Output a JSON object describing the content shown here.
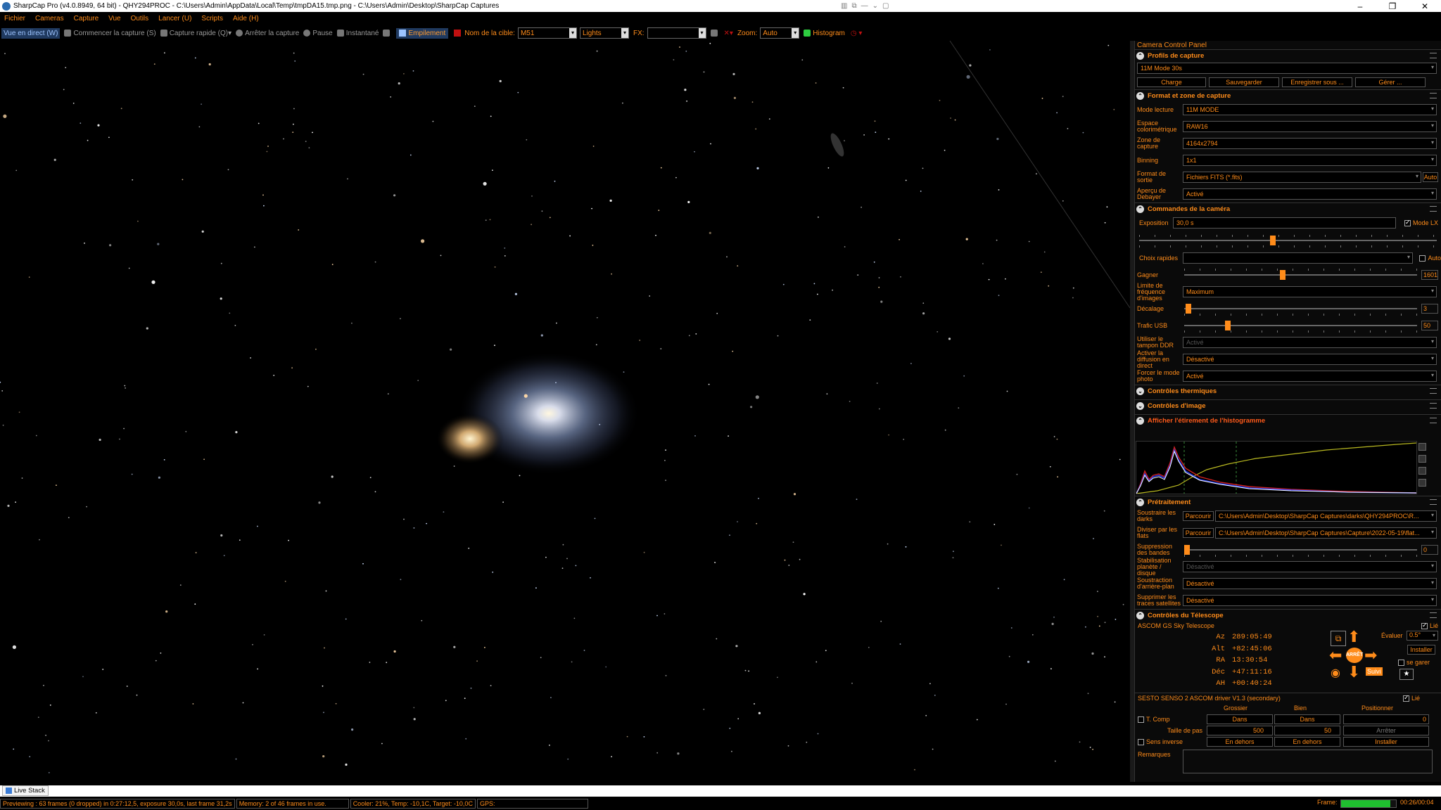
{
  "window": {
    "title": "SharpCap Pro (v4.0.8949, 64 bit) - QHY294PROC - C:\\Users\\Admin\\AppData\\Local\\Temp\\tmpDA15.tmp.png - C:\\Users\\Admin\\Desktop\\SharpCap Captures",
    "minimize": "–",
    "maximize": "❐",
    "close": "✕"
  },
  "menu": [
    "Fichier",
    "Cameras",
    "Capture",
    "Vue",
    "Outils",
    "Lancer (U)",
    "Scripts",
    "Aide (H)"
  ],
  "toolbar": {
    "live_view": "Vue en direct (W)",
    "start_capture": "Commencer la capture (S)",
    "quick_capture": "Capture rapide (Q)",
    "stop_capture": "Arrêter la capture",
    "pause": "Pause",
    "snapshot": "Instantané",
    "stacking": "Empilement",
    "target_label": "Nom de la cible:",
    "target_value": "M51",
    "frame_type": "Lights",
    "fx_label": "FX:",
    "fx_value": "",
    "zoom_label": "Zoom:",
    "zoom_value": "Auto",
    "histogram": "Histogram"
  },
  "panel": {
    "title": "Camera Control Panel",
    "profiles": {
      "heading": "Profils de capture",
      "current": "11M Mode 30s",
      "buttons": [
        "Charge",
        "Sauvegarder",
        "Enregistrer sous ...",
        "Gérer ..."
      ]
    },
    "format": {
      "heading": "Format et zone de capture",
      "rows": [
        {
          "label": "Mode lecture",
          "value": "11M MODE"
        },
        {
          "label": "Espace colorimétrique",
          "value": "RAW16"
        },
        {
          "label": "Zone de capture",
          "value": "4164x2794"
        },
        {
          "label": "Binning",
          "value": "1x1"
        },
        {
          "label": "Format de sortie",
          "value": "Fichiers FITS (*.fits)"
        },
        {
          "label": "Aperçu de Debayer",
          "value": "Activé"
        }
      ],
      "auto_button": "Auto"
    },
    "camera": {
      "heading": "Commandes de la caméra",
      "exposure_label": "Exposition",
      "exposure_value": "30,0 s",
      "lx_label": "Mode LX",
      "quick_label": "Choix rapides",
      "auto_label": "Auto",
      "gain_label": "Gagner",
      "gain_value": "1601",
      "framerate_label": "Limite de fréquence d'images",
      "framerate_value": "Maximum",
      "offset_label": "Décalage",
      "offset_value": "3",
      "usb_label": "Trafic USB",
      "usb_value": "50",
      "ddr_label": "Utiliser le tampon DDR",
      "ddr_value": "Activé",
      "broadcast_label": "Activer la diffusion en direct",
      "broadcast_value": "Désactivé",
      "photo_label": "Forcer le mode photo",
      "photo_value": "Activé"
    },
    "thermal": {
      "heading": "Contrôles thermiques"
    },
    "image": {
      "heading": "Contrôles d'image"
    },
    "histogram": {
      "heading": "Afficher l'étirement de l'histogramme"
    },
    "preprocessing": {
      "heading": "Prétraitement",
      "darks_label": "Soustraire les darks",
      "darks_browse": "Parcourir",
      "darks_path": "C:\\Users\\Admin\\Desktop\\SharpCap Captures\\darks\\QHY294PROC\\R...",
      "flats_label": "Diviser par les flats",
      "flats_browse": "Parcourir",
      "flats_path": "C:\\Users\\Admin\\Desktop\\SharpCap Captures\\Capture\\2022-05-19\\flat...",
      "banding_label": "Suppression des bandes",
      "banding_value": "0",
      "stabilization_label": "Stabilisation planète / disque",
      "stabilization_value": "Désactivé",
      "background_label": "Soustraction d'arrière-plan",
      "background_value": "Désactivé",
      "satellite_label": "Supprimer les traces satellites",
      "satellite_value": "Désactivé"
    },
    "telescope": {
      "heading": "Contrôles du Télescope",
      "driver": "ASCOM GS Sky Telescope",
      "linked_label": "Lié",
      "coords": [
        {
          "key": "Az",
          "value": "289:05:49"
        },
        {
          "key": "Alt",
          "value": "+82:45:06"
        },
        {
          "key": "RA",
          "value": "13:30:54"
        },
        {
          "key": "Déc",
          "value": "+47:11:16"
        },
        {
          "key": "AH",
          "value": "+00:40:24"
        }
      ],
      "rate_label": "Évaluer",
      "rate_value": "0.5°",
      "install_button": "Installer",
      "park_label": "se garer",
      "stop_label": "ARRÊT",
      "follow_button": "Suivi"
    },
    "focuser": {
      "driver": "SESTO SENSO 2 ASCOM driver V1.3 (secondary)",
      "linked_label": "Lié",
      "coarse_label": "Grossier",
      "fine_label": "Bien",
      "position_label": "Positionner",
      "tcomp_label": "T. Comp",
      "in_coarse": "Dans",
      "in_fine": "Dans",
      "position_value": "0",
      "step_label": "Taille de pas",
      "step_coarse": "500",
      "step_fine": "50",
      "stop_button": "Arrêter",
      "reverse_label": "Sens inverse",
      "out_coarse": "En dehors",
      "out_fine": "En dehors",
      "install_button": "Installer"
    },
    "notes_label": "Remarques"
  },
  "tabs": {
    "live_stack": "Live Stack"
  },
  "status": {
    "preview": "Previewing : 63 frames (0 dropped) in 0:27:12,5, exposure 30,0s, last frame 31,2s",
    "memory": "Memory: 2 of 46 frames in use.",
    "cooler": "Cooler: 21%, Temp: -10,1C, Target: -10,0C",
    "gps": "GPS:",
    "frame_label": "Frame:",
    "frame_progress": 0.9,
    "elapsed": "00:26/00:04"
  }
}
